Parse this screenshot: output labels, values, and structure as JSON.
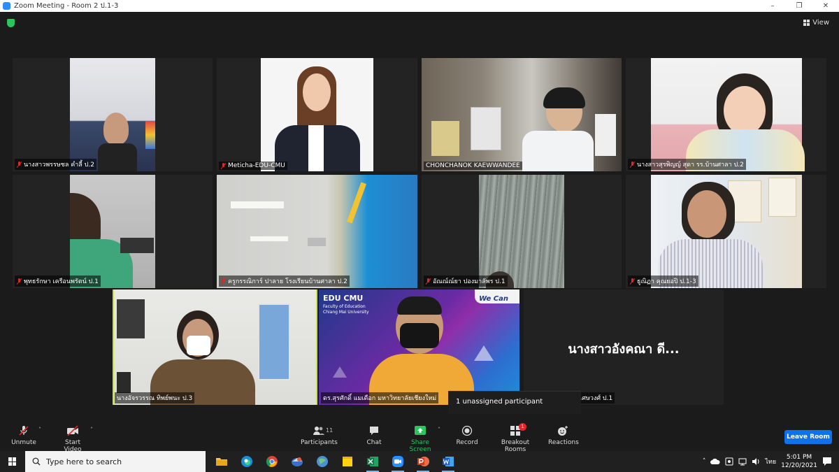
{
  "window": {
    "title": "Zoom Meeting - Room 2 ป.1-3",
    "minimize": "–",
    "maximize": "❐",
    "close": "✕"
  },
  "view_button": {
    "label": "View"
  },
  "participants": [
    {
      "name": "นางสาวพรรษชล คำลี้ ป.2",
      "muted": true,
      "scene": "classroom-bright"
    },
    {
      "name": "Meticha-EDU-CMU",
      "muted": true,
      "scene": "white-portrait"
    },
    {
      "name": "CHONCHANOK KAEWWANDEE",
      "muted": false,
      "scene": "office"
    },
    {
      "name": "นางสาวสุรพิญญ์ สุดา รร.บ้านศาลา ป.2",
      "muted": true,
      "scene": "pink-room"
    },
    {
      "name": "พุทธรักษา เครือนพรัตน์ ป.1",
      "muted": true,
      "scene": "dim-room"
    },
    {
      "name": "ครูกรรณิการ์ ปาลาย โรงเรียนบ้านศาลา ป.2",
      "muted": true,
      "scene": "ceiling-curtain"
    },
    {
      "name": "อัณณ์ณ์ยา ปองมาลัพร ป.1",
      "muted": true,
      "scene": "rain"
    },
    {
      "name": "ธูณิฏา คุณยอปิ ป.1-3",
      "muted": true,
      "scene": "poster-room"
    },
    {
      "name": "นางอัจรวรรณ ทิพย์พนะ ป.3",
      "muted": false,
      "scene": "mask-woman",
      "active": true
    },
    {
      "name": "ดร.สุรศักดิ์ แมเดือก มหาวิทยาลัยเชียงใหม่",
      "muted": false,
      "scene": "edu-banner",
      "banner_title": "EDU CMU",
      "banner_sub1": "Faculty of Education",
      "banner_sub2": "Chiang Mai University",
      "banner_right": "We Can"
    },
    {
      "name": "นางสาวอังคณา ดีวีเศษวงศ์ ป.1",
      "muted": false,
      "scene": "no-video",
      "display_name": "นางสาวอังคณา ดี..."
    }
  ],
  "tooltip": {
    "text": "1 unassigned participant"
  },
  "toolbar": {
    "unmute": "Unmute",
    "start_video": "Start Video",
    "participants": "Participants",
    "participants_count": "11",
    "chat": "Chat",
    "share_screen": "Share Screen",
    "record": "Record",
    "breakout_rooms": "Breakout Rooms",
    "breakout_badge": "1",
    "reactions": "Reactions",
    "leave_room": "Leave Room"
  },
  "taskbar": {
    "search_placeholder": "Type here to search",
    "language": "ไทย",
    "time": "5:01 PM",
    "date": "12/20/2021"
  },
  "colors": {
    "accent": "#0e72ed",
    "active_speaker": "#c8e04a",
    "share_green": "#2bc45d",
    "muted_red": "#e02828"
  }
}
